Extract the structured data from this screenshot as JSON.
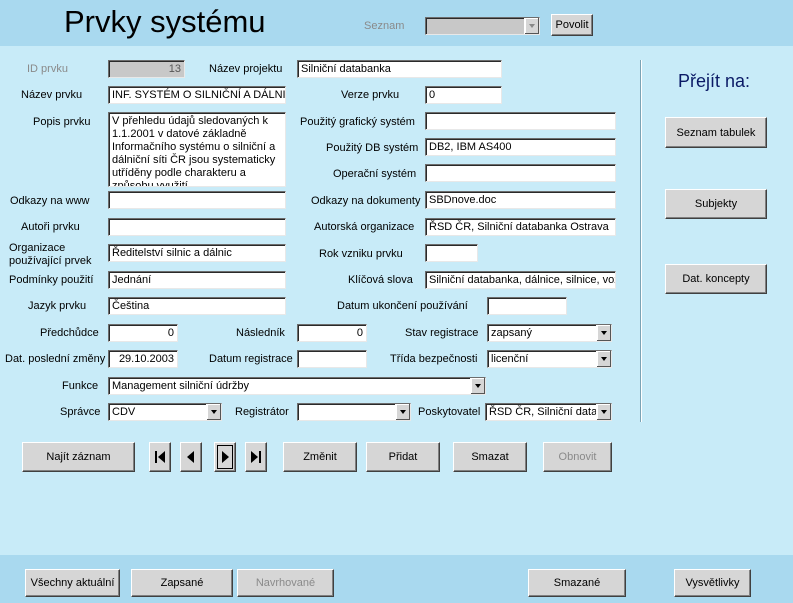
{
  "header": {
    "title": "Prvky systému",
    "seznam_label": "Seznam",
    "seznam_value": "",
    "povolit_label": "Povolit"
  },
  "form": {
    "id_prvku_label": "ID prvku",
    "id_prvku_value": "13",
    "nazev_projektu_label": "Název projektu",
    "nazev_projektu_value": "Silniční databanka",
    "nazev_prvku_label": "Název prvku",
    "nazev_prvku_value": "INF. SYSTÉM O SILNIČNÍ A DÁLNIČ",
    "verze_label": "Verze prvku",
    "verze_value": "0",
    "popis_label": "Popis prvku",
    "popis_value": "V přehledu údajů sledovaných k 1.1.2001 v datové základně Informačního systému o silniční a dálniční síti ČR jsou systematicky utříděny podle charakteru a způsobu využití",
    "graf_system_label": "Použitý grafický systém",
    "graf_system_value": "",
    "db_system_label": "Použitý DB systém",
    "db_system_value": "DB2, IBM AS400",
    "op_system_label": "Operační systém",
    "op_system_value": "",
    "odkazy_www_label": "Odkazy na www",
    "odkazy_www_value": "",
    "odkazy_dok_label": "Odkazy na dokumenty",
    "odkazy_dok_value": "SBDnove.doc",
    "autori_label": "Autoři prvku",
    "autori_value": "",
    "aut_org_label": "Autorská organizace",
    "aut_org_value": "ŘSD ČR, Silniční databanka Ostrava",
    "org_pouz_label": "Organizace používající prvek",
    "org_pouz_value": "Ředitelství silnic a dálnic",
    "rok_vzniku_label": "Rok vzniku prvku",
    "rok_vzniku_value": "",
    "podminky_label": "Podmínky použití",
    "podminky_value": "Jednání",
    "klic_slova_label": "Klíčová slova",
    "klic_slova_value": "Silniční databanka, dálnice, silnice, voz",
    "jazyk_label": "Jazyk prvku",
    "jazyk_value": "Čeština",
    "datum_ukonc_label": "Datum ukončení používání",
    "datum_ukonc_value": "",
    "predchudce_label": "Předchůdce",
    "predchudce_value": "0",
    "naslednik_label": "Následník",
    "naslednik_value": "0",
    "stav_reg_label": "Stav registrace",
    "stav_reg_value": "zapsaný",
    "dat_posl_zmeny_label": "Dat. poslední změny",
    "dat_posl_zmeny_value": "29.10.2003",
    "datum_reg_label": "Datum registrace",
    "datum_reg_value": "",
    "trida_bezp_label": "Třída bezpečnosti",
    "trida_bezp_value": "licenční",
    "funkce_label": "Funkce",
    "funkce_value": "Management silniční údržby",
    "spravce_label": "Správce",
    "spravce_value": "CDV",
    "registrator_label": "Registrátor",
    "registrator_value": "",
    "poskytovatel_label": "Poskytovatel",
    "poskytovatel_value": "ŘSD ČR, Silniční data"
  },
  "toolbar": {
    "najit": "Najít záznam",
    "zmenit": "Změnit",
    "pridat": "Přidat",
    "smazat": "Smazat",
    "obnovit": "Obnovit"
  },
  "goto": {
    "title": "Přejít na:",
    "seznam_tabulek": "Seznam tabulek",
    "subjekty": "Subjekty",
    "dat_koncepty": "Dat. koncepty"
  },
  "footer": {
    "vsechny": "Všechny aktuální",
    "zapsane": "Zapsané",
    "navrhovane": "Navrhované",
    "smazane": "Smazané",
    "vysvetlivky": "Vysvětlivky"
  }
}
